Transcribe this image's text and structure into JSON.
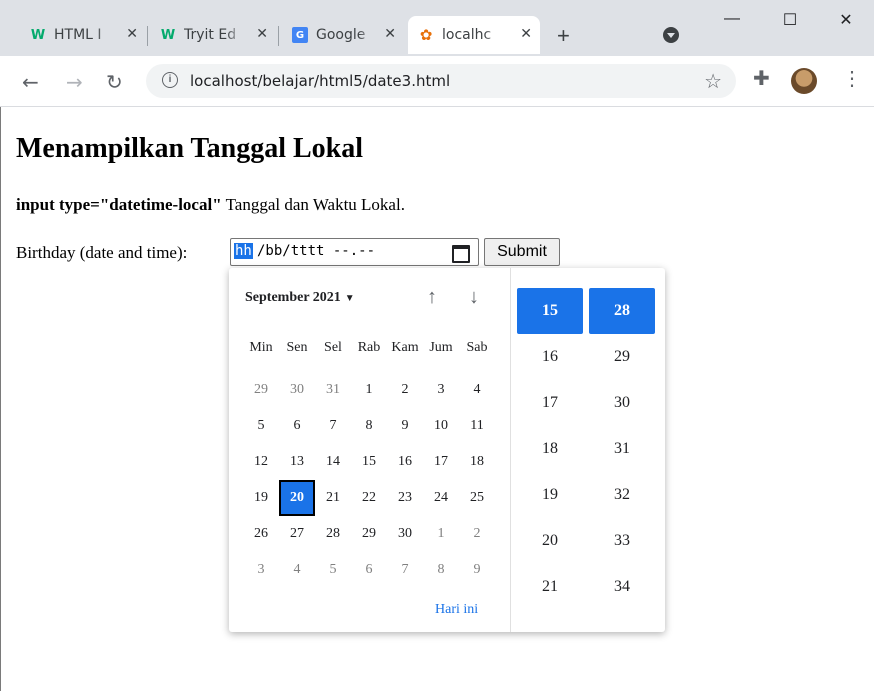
{
  "browser": {
    "tabs": [
      {
        "title": "HTML I",
        "favicon": "w3-icon"
      },
      {
        "title": "Tryit Ed",
        "favicon": "w3-icon"
      },
      {
        "title": "Google",
        "favicon": "translate-icon"
      },
      {
        "title": "localhc",
        "favicon": "localhost-icon"
      }
    ],
    "url": "localhost/belajar/html5/date3.html"
  },
  "page": {
    "heading": "Menampilkan Tanggal Lokal",
    "code_label": "input type=\"datetime-local\"",
    "desc_text": " Tanggal dan Waktu Lokal.",
    "birthday_label": "Birthday (date and time):",
    "input_hh": "hh",
    "input_rest": "/bb/tttt --.--",
    "submit_label": "Submit"
  },
  "picker": {
    "month_label": "September 2021",
    "weekdays": [
      "Min",
      "Sen",
      "Sel",
      "Rab",
      "Kam",
      "Jum",
      "Sab"
    ],
    "weeks": [
      [
        "29",
        "30",
        "31",
        "1",
        "2",
        "3",
        "4"
      ],
      [
        "5",
        "6",
        "7",
        "8",
        "9",
        "10",
        "11"
      ],
      [
        "12",
        "13",
        "14",
        "15",
        "16",
        "17",
        "18"
      ],
      [
        "19",
        "20",
        "21",
        "22",
        "23",
        "24",
        "25"
      ],
      [
        "26",
        "27",
        "28",
        "29",
        "30",
        "1",
        "2"
      ],
      [
        "3",
        "4",
        "5",
        "6",
        "7",
        "8",
        "9"
      ]
    ],
    "selected_day": "20",
    "today_label": "Hari ini",
    "hours": [
      "15",
      "16",
      "17",
      "18",
      "19",
      "20",
      "21"
    ],
    "minutes": [
      "28",
      "29",
      "30",
      "31",
      "32",
      "33",
      "34"
    ]
  }
}
